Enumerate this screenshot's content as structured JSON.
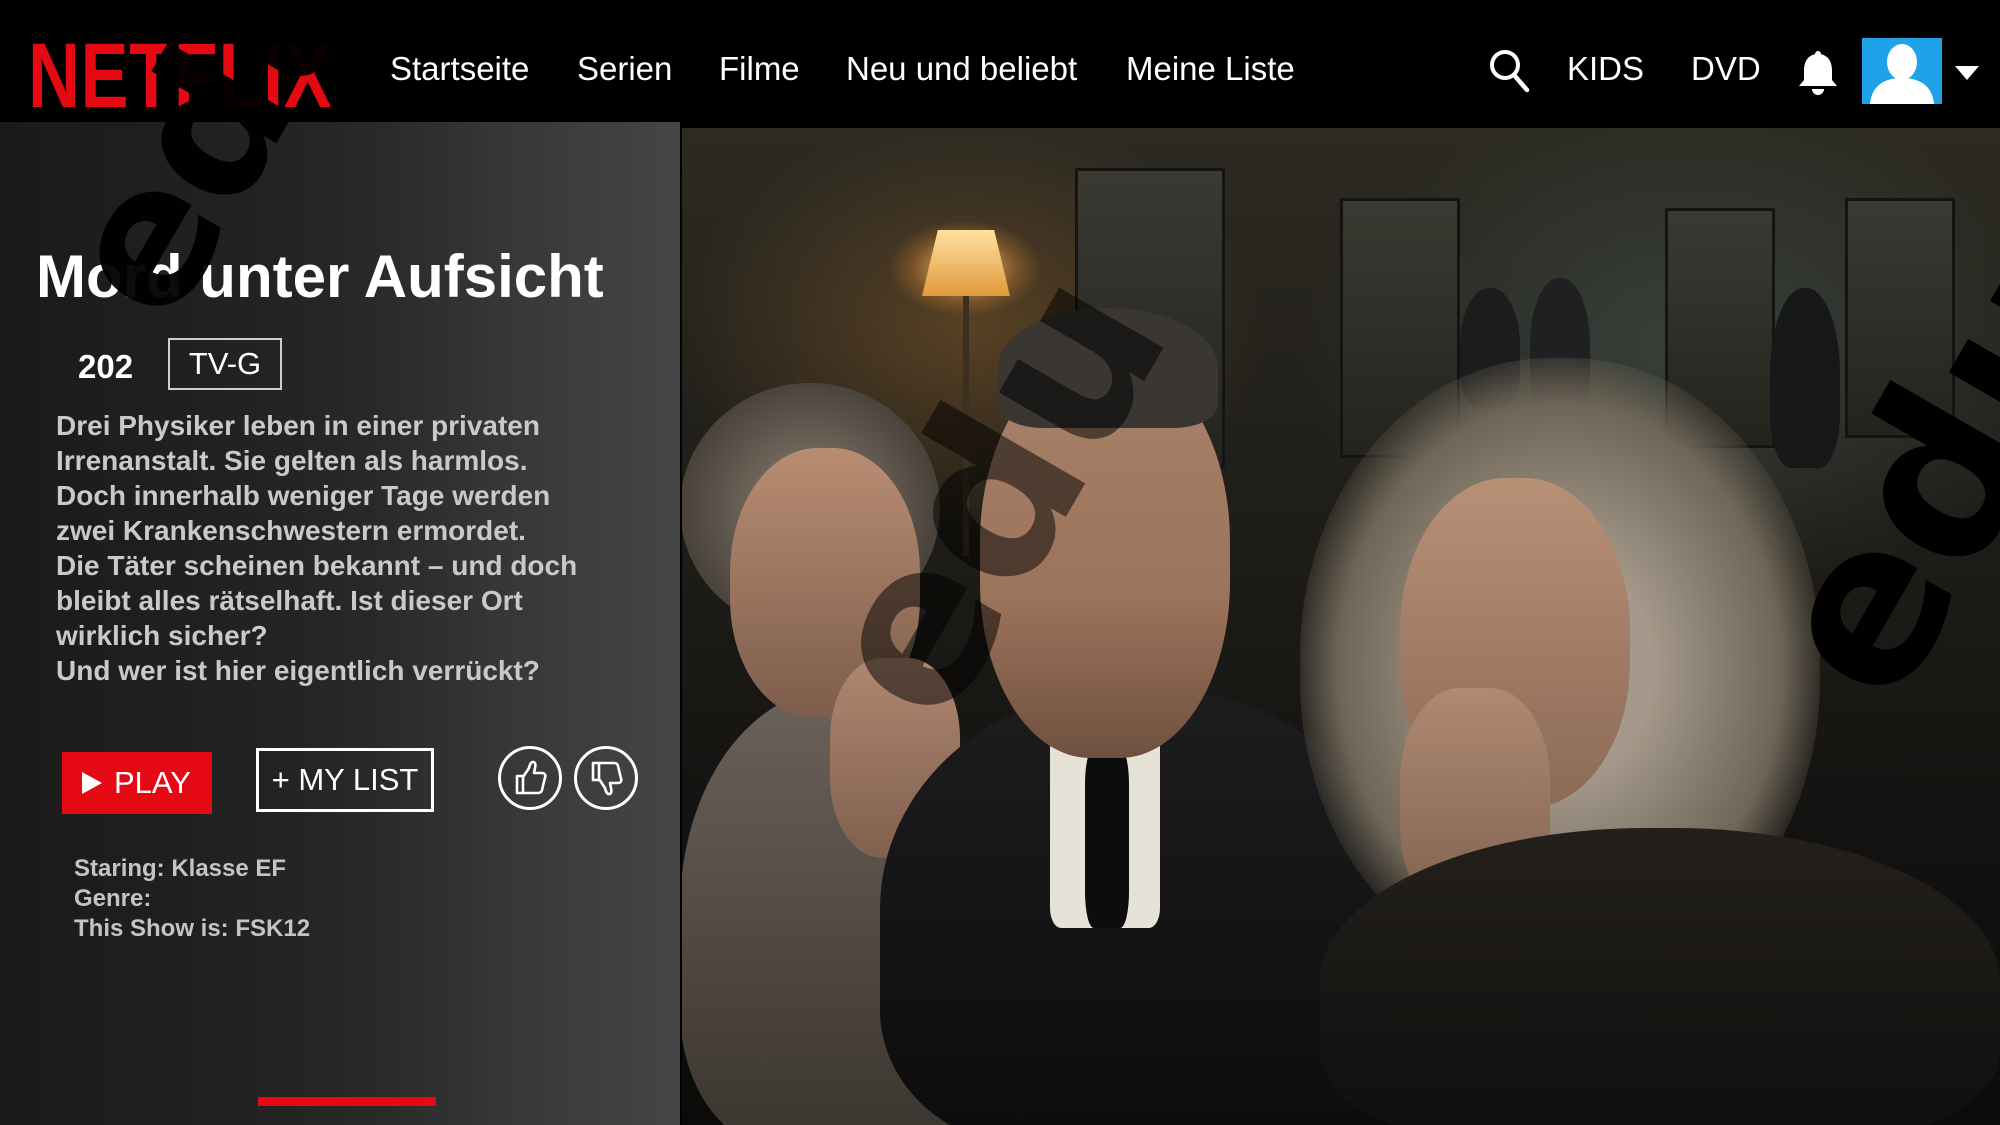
{
  "navbar": {
    "logo": "NETFLIX",
    "links": [
      "Startseite",
      "Serien",
      "Filme",
      "Neu und beliebt",
      "Meine Liste"
    ],
    "kids": "KIDS",
    "dvd": "DVD",
    "icons": [
      "search-icon",
      "bell-icon",
      "avatar",
      "caret-down-icon"
    ]
  },
  "show": {
    "title": "Mord unter Aufsicht",
    "year": "202",
    "rating": "TV-G",
    "description": [
      "Drei Physiker leben in einer privaten",
      "Irrenanstalt. Sie gelten als harmlos.",
      "Doch innerhalb weniger Tage werden",
      "zwei Krankenschwestern ermordet.",
      "Die Täter scheinen bekannt – und doch",
      "bleibt alles rätselhaft. Ist dieser Ort",
      "wirklich sicher?",
      "Und wer ist hier eigentlich verrückt?"
    ],
    "play_label": "PLAY",
    "mylist_label": "+ MY LIST",
    "staring": "Staring: Klasse EF",
    "genre": "Genre:",
    "fsk": "This Show is: FSK12",
    "progress_fraction": 0.0
  },
  "watermark": {
    "text": "edu"
  },
  "colors": {
    "accent": "#e50914",
    "avatar_bg": "#1fa2e8",
    "background": "#000000"
  }
}
